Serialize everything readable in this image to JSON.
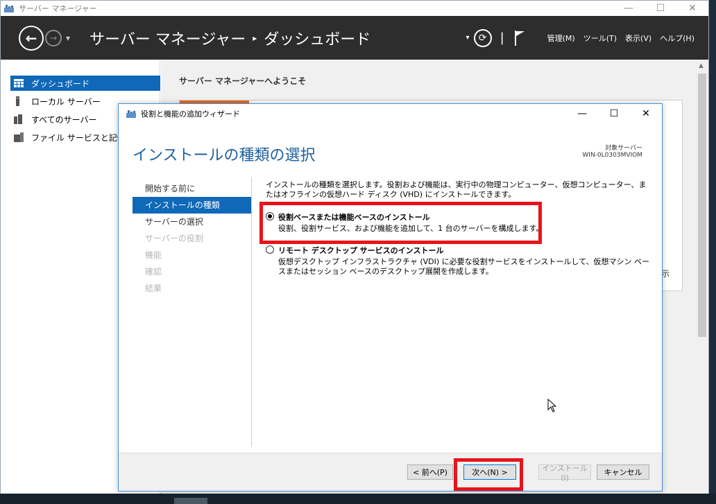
{
  "outer_window": {
    "title": "サーバー マネージャー",
    "controls": {
      "minimize": "—",
      "maximize": "☐",
      "close": "✕"
    }
  },
  "header": {
    "breadcrumb_root": "サーバー マネージャー",
    "breadcrumb_separator": "▸",
    "breadcrumb_page": "ダッシュボード",
    "menu": {
      "manage": "管理(M)",
      "tools": "ツール(T)",
      "view": "表示(V)",
      "help": "ヘルプ(H)"
    }
  },
  "sidebar": {
    "items": [
      {
        "label": "ダッシュボード",
        "icon": "dashboard-icon",
        "active": true
      },
      {
        "label": "ローカル サーバー",
        "icon": "local-server-icon",
        "active": false
      },
      {
        "label": "すべてのサーバー",
        "icon": "all-servers-icon",
        "active": false
      },
      {
        "label": "ファイル サービスと記憶",
        "icon": "file-services-icon",
        "active": false
      }
    ]
  },
  "content": {
    "welcome": "サーバー マネージャーへようこそ",
    "peek_text": "示"
  },
  "dialog": {
    "title": "役割と機能の追加ウィザード",
    "controls": {
      "minimize": "—",
      "maximize": "☐",
      "close": "✕"
    },
    "heading": "インストールの種類の選択",
    "target_label": "対象サーバー",
    "target_name": "WIN-0L0303MVIOM",
    "steps": [
      {
        "label": "開始する前に",
        "state": "normal"
      },
      {
        "label": "インストールの種類",
        "state": "active"
      },
      {
        "label": "サーバーの選択",
        "state": "normal"
      },
      {
        "label": "サーバーの役割",
        "state": "disabled"
      },
      {
        "label": "機能",
        "state": "disabled"
      },
      {
        "label": "確認",
        "state": "disabled"
      },
      {
        "label": "結果",
        "state": "disabled"
      }
    ],
    "description": "インストールの種類を選択します。役割および機能は、実行中の物理コンピューター、仮想コンピューター、またはオフラインの仮想ハード ディスク (VHD) にインストールできます。",
    "options": [
      {
        "title": "役割ベースまたは機能ベースのインストール",
        "desc": "役割、役割サービス、および機能を追加して、1 台のサーバーを構成します。",
        "checked": true
      },
      {
        "title": "リモート デスクトップ サービスのインストール",
        "desc": "仮想デスクトップ インフラストラクチャ (VDI) に必要な役割サービスをインストールして、仮想マシン ベースまたはセッション ベースのデスクトップ展開を作成します。",
        "checked": false
      }
    ],
    "buttons": {
      "previous": "< 前へ(P)",
      "next": "次へ(N) >",
      "install": "インストール(I)",
      "cancel": "キャンセル"
    }
  },
  "colors": {
    "accent": "#0f68b8",
    "highlight": "#e8141b",
    "header_bg": "#2d2d2d",
    "heading_blue": "#1e5f9e"
  }
}
